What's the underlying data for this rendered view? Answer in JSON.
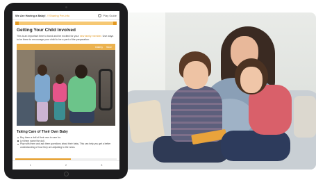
{
  "header": {
    "crumb": "We Are Having a Baby!",
    "crumb_sub": "// Sharing Pre-Info",
    "guide_label": "Play Guide"
  },
  "article": {
    "title": "Getting Your Child Involved",
    "intro": "This is an important time to bond and be excited for your",
    "intro_link": "new family member.",
    "intro_cont": "Use ways to be there to encourage your child to be a part of the preparation.",
    "image_toolbar": [
      "Gallery",
      "Save"
    ],
    "subtitle": "Taking Care of Their Own Baby",
    "bullets": [
      "Buy them a doll of their own to care for.",
      "Let them name the doll.",
      "Play with them and ask them questions about their baby. This can help you get a better understanding of how they are adjusting to the news."
    ]
  },
  "progress": 0.55,
  "bottom_nav": [
    "1",
    "2",
    "3"
  ],
  "colors": {
    "accent": "#e49a22",
    "toolbar": "#ebb24f"
  }
}
